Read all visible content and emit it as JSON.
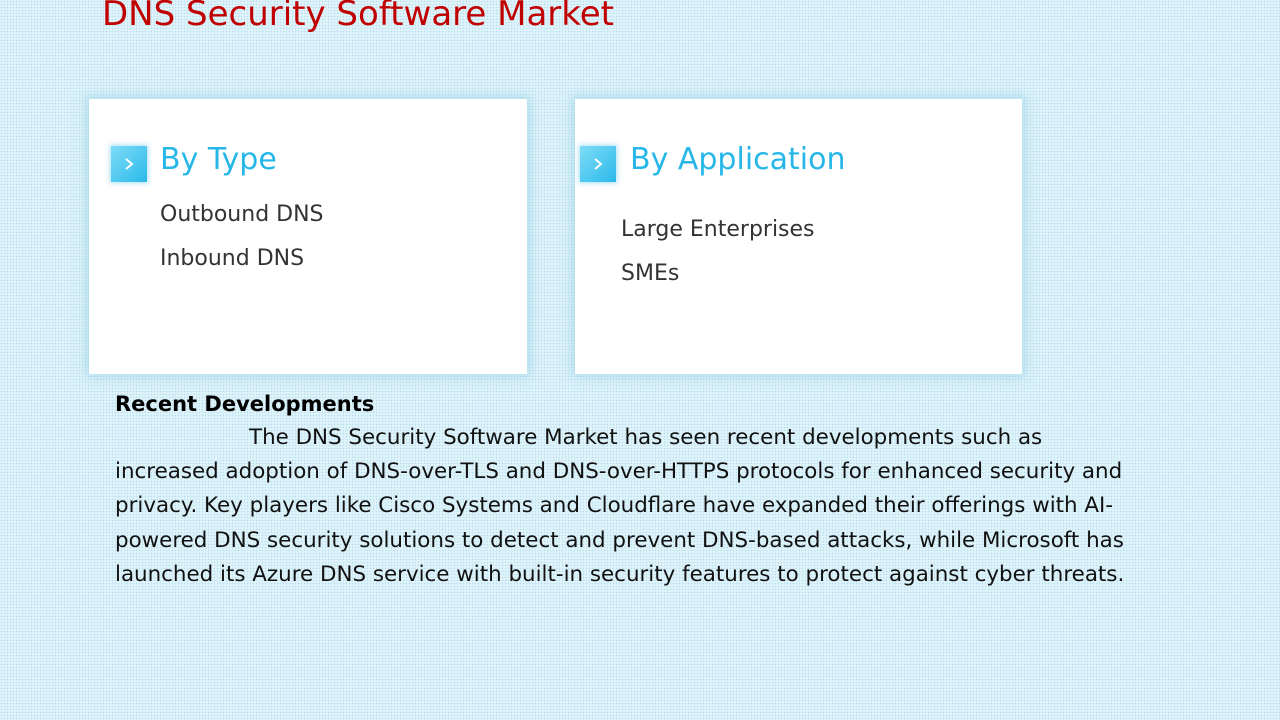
{
  "title": "DNS Security Software Market",
  "cards": [
    {
      "heading": "By Type",
      "items": [
        "Outbound DNS",
        "Inbound DNS"
      ]
    },
    {
      "heading": "By Application",
      "items": [
        "Large Enterprises",
        "SMEs"
      ]
    }
  ],
  "recent_developments": {
    "heading": "Recent Developments",
    "body": "The DNS Security Software Market has seen recent developments such as increased adoption of DNS-over-TLS and DNS-over-HTTPS protocols for enhanced security and privacy. Key players like Cisco Systems and Cloudflare have expanded their offerings with AI-powered DNS security solutions to detect and prevent DNS-based attacks, while Microsoft has launched its Azure DNS service with built-in security features to protect against cyber threats."
  },
  "icons": {
    "card_arrow": "chevron-right-icon"
  },
  "colors": {
    "title": "#c00000",
    "heading_accent": "#26b7e8",
    "background": "#dff3fa"
  }
}
